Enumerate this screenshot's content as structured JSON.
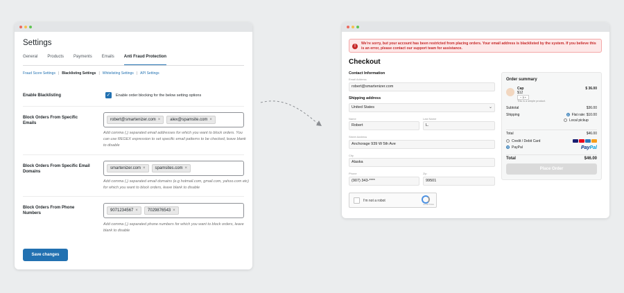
{
  "settings": {
    "title": "Settings",
    "tabs": [
      "General",
      "Products",
      "Payments",
      "Emails",
      "Anti Fraud Protection"
    ],
    "active_tab": "Anti Fraud Protection",
    "subtabs": [
      "Fraud Score Settings",
      "Blacklisting Settings",
      "Whitelisting Settings",
      "API Settings"
    ],
    "sub_sep": "|",
    "enable": {
      "label": "Enable Blacklisting",
      "checkbox_label": "Enable order blocking for the below setting options"
    },
    "emails": {
      "label": "Block Orders From Specific Emails",
      "tags": [
        "robert@smartenizer.com",
        "alex@spamsite.com"
      ],
      "help": "Add comma (,) separated email addresses for which you want to block orders. You can use REGEX expression to set specific email patterns to be checked, leave blank to disable"
    },
    "domains": {
      "label": "Block Orders From Specific Email Domains",
      "tags": [
        "smartenizer.com",
        "spamsites.com"
      ],
      "help": "Add comma (,) separated email domains (e.g hotmail.com, gmail.com, yahoo.com etc) for which you want to block orders, leave blank to disable"
    },
    "phones": {
      "label": "Block Orders From Phone Numbers",
      "tags": [
        "9071234567",
        "7029876543"
      ],
      "help": "Add comma (,) separated phone numbers for which you want to block orders, leave blank to disable"
    },
    "tag_remove": "×",
    "save": "Save changes"
  },
  "checkout": {
    "alert": "We're sorry, but your account has been restricted from placing orders. Your email address is blacklisted by the system. If you believe this is an error, please contact our support team for assistance.",
    "title": "Checkout",
    "contact_title": "Contact Information",
    "email_label": "Email Address",
    "email": "robert@smartenizer.com",
    "shipping_title": "Shipping address",
    "country": "United States",
    "name_label": "Name",
    "name": "Robert",
    "lastname_label": "Last Name",
    "lastname": "L.",
    "street_label": "Street Address",
    "street": "Anchorage 939 W 5th Ave",
    "city_label": "City",
    "city": "Alaska",
    "phone_label": "Phone",
    "phone": "(907) 343-****",
    "zip_label": "Zip",
    "zip": "99501",
    "captcha": "I'm not a robot",
    "captcha_small": "reCAPTCHA",
    "summary": {
      "title": "Order summary",
      "product": "Cap",
      "product_price": "$12",
      "product_total": "$ 36.00",
      "qty": "3",
      "product_note": "This is a simple product.",
      "subtotal_label": "Subtotal",
      "subtotal": "$36.00",
      "shipping_label": "Shipping",
      "shipping_flat": "Flat rate: $10.00",
      "shipping_local": "Local pickup",
      "total_label": "Total",
      "total": "$46.00",
      "pay_card": "Credit / Debit Card",
      "pay_paypal": "PayPal",
      "paypal_logo_a": "Pay",
      "paypal_logo_b": "Pal",
      "grand_label": "Total",
      "grand": "$46.00",
      "place_order": "Place Order"
    }
  }
}
